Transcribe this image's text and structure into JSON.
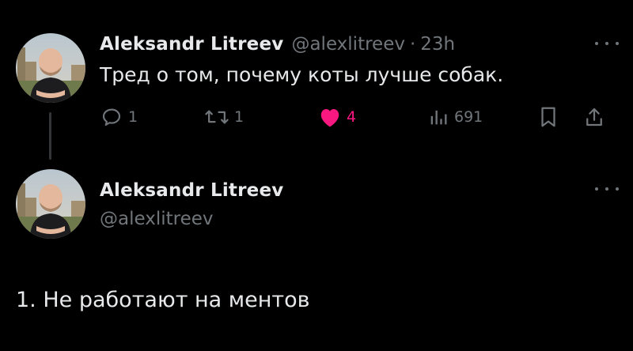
{
  "tweet1": {
    "display_name": "Aleksandr Litreev",
    "handle": "@alexlitreev",
    "separator": "·",
    "time": "23h",
    "text": "Тред о том, почему коты лучше собак.",
    "reply_count": "1",
    "retweet_count": "1",
    "like_count": "4",
    "view_count": "691",
    "like_color": "#f91880"
  },
  "tweet2": {
    "display_name": "Aleksandr Litreev",
    "handle": "@alexlitreev",
    "text": "1. Не работают на ментов"
  },
  "icons": {
    "reply": "reply-icon",
    "retweet": "retweet-icon",
    "like": "heart-icon",
    "views": "views-icon",
    "bookmark": "bookmark-icon",
    "share": "share-icon",
    "more": "more-icon"
  },
  "colors": {
    "background": "#000000",
    "text_primary": "#e7e9ea",
    "text_secondary": "#71767b",
    "thread_line": "#333639"
  }
}
